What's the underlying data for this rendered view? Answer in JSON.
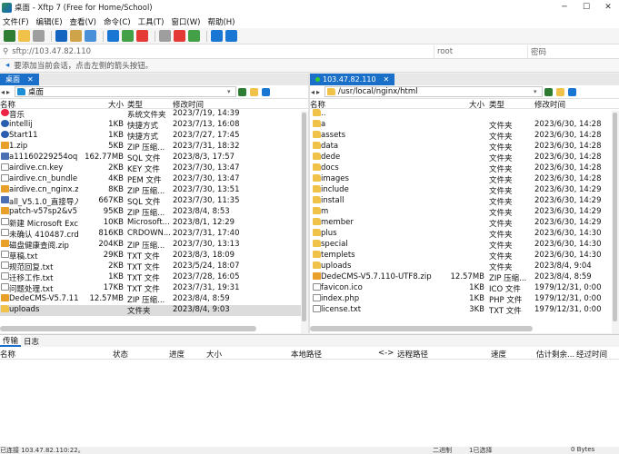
{
  "title": "桌面 - Xftp 7 (Free for Home/School)",
  "menu": [
    "文件(F)",
    "编辑(E)",
    "查看(V)",
    "命令(C)",
    "工具(T)",
    "窗口(W)",
    "帮助(H)"
  ],
  "address": {
    "host": "sftp://103.47.82.110",
    "user_placeholder": "root",
    "pass_placeholder": "密码"
  },
  "hint": "要添加当前会话，点击左侧的箭头按钮。",
  "left": {
    "tab": "桌面",
    "path": "桌面",
    "headers": [
      "名称",
      "大小",
      "类型",
      "修改时间"
    ],
    "files": [
      {
        "n": "音乐",
        "s": "",
        "t": "系统文件夹",
        "d": "2023/7/19, 14:39",
        "i": "sys"
      },
      {
        "n": "intellij",
        "s": "1KB",
        "t": "快捷方式",
        "d": "2023/7/13, 16:08",
        "i": "lnk"
      },
      {
        "n": "Start11",
        "s": "1KB",
        "t": "快捷方式",
        "d": "2023/7/27, 17:45",
        "i": "lnk"
      },
      {
        "n": "1.zip",
        "s": "5KB",
        "t": "ZIP 压缩...",
        "d": "2023/7/31, 18:32",
        "i": "zip"
      },
      {
        "n": "a11160229254oq.sql",
        "s": "162.77MB",
        "t": "SQL 文件",
        "d": "2023/8/3, 17:57",
        "i": "sql"
      },
      {
        "n": "airdive.cn.key",
        "s": "2KB",
        "t": "KEY 文件",
        "d": "2023/7/30, 13:47",
        "i": "file"
      },
      {
        "n": "airdive.cn_bundle....",
        "s": "4KB",
        "t": "PEM 文件",
        "d": "2023/7/30, 13:47",
        "i": "file"
      },
      {
        "n": "airdive.cn_nginx.zip",
        "s": "8KB",
        "t": "ZIP 压缩...",
        "d": "2023/7/30, 13:51",
        "i": "zip"
      },
      {
        "n": "all_V5.1.0_直接导入....",
        "s": "667KB",
        "t": "SQL 文件",
        "d": "2023/7/30, 11:35",
        "i": "sql"
      },
      {
        "n": "patch-v57sp2&v57...",
        "s": "95KB",
        "t": "ZIP 压缩...",
        "d": "2023/8/4, 8:53",
        "i": "zip"
      },
      {
        "n": "新建 Microsoft Exc...",
        "s": "10KB",
        "t": "Microsoft...",
        "d": "2023/8/1, 12:29",
        "i": "file"
      },
      {
        "n": "未确认 410487.crdo...",
        "s": "816KB",
        "t": "CRDOWN...",
        "d": "2023/7/31, 17:40",
        "i": "file"
      },
      {
        "n": "磁盘健康查阅.zip",
        "s": "204KB",
        "t": "ZIP 压缩...",
        "d": "2023/7/30, 13:13",
        "i": "zip"
      },
      {
        "n": "草稿.txt",
        "s": "29KB",
        "t": "TXT 文件",
        "d": "2023/8/3, 18:09",
        "i": "file"
      },
      {
        "n": "规范回复.txt",
        "s": "2KB",
        "t": "TXT 文件",
        "d": "2023/5/24, 18:07",
        "i": "file"
      },
      {
        "n": "迁移工作.txt",
        "s": "1KB",
        "t": "TXT 文件",
        "d": "2023/7/28, 16:05",
        "i": "file"
      },
      {
        "n": "问题处理.txt",
        "s": "17KB",
        "t": "TXT 文件",
        "d": "2023/7/31, 19:31",
        "i": "file"
      },
      {
        "n": "DedeCMS-V5.7.11...",
        "s": "12.57MB",
        "t": "ZIP 压缩...",
        "d": "2023/8/4, 8:59",
        "i": "zip"
      },
      {
        "n": "uploads",
        "s": "",
        "t": "文件夹",
        "d": "2023/8/4, 9:03",
        "i": "folder",
        "sel": true
      }
    ]
  },
  "right": {
    "tab": "103.47.82.110",
    "path": "/usr/local/nginx/html",
    "headers": [
      "名称",
      "大小",
      "类型",
      "修改时间"
    ],
    "files": [
      {
        "n": "..",
        "s": "",
        "t": "",
        "d": "",
        "i": "folder"
      },
      {
        "n": "a",
        "s": "",
        "t": "文件夹",
        "d": "2023/6/30, 14:28",
        "i": "folder"
      },
      {
        "n": "assets",
        "s": "",
        "t": "文件夹",
        "d": "2023/6/30, 14:28",
        "i": "folder"
      },
      {
        "n": "data",
        "s": "",
        "t": "文件夹",
        "d": "2023/6/30, 14:28",
        "i": "folder"
      },
      {
        "n": "dede",
        "s": "",
        "t": "文件夹",
        "d": "2023/6/30, 14:28",
        "i": "folder"
      },
      {
        "n": "docs",
        "s": "",
        "t": "文件夹",
        "d": "2023/6/30, 14:28",
        "i": "folder"
      },
      {
        "n": "images",
        "s": "",
        "t": "文件夹",
        "d": "2023/6/30, 14:28",
        "i": "folder"
      },
      {
        "n": "include",
        "s": "",
        "t": "文件夹",
        "d": "2023/6/30, 14:29",
        "i": "folder"
      },
      {
        "n": "install",
        "s": "",
        "t": "文件夹",
        "d": "2023/6/30, 14:29",
        "i": "folder"
      },
      {
        "n": "m",
        "s": "",
        "t": "文件夹",
        "d": "2023/6/30, 14:29",
        "i": "folder"
      },
      {
        "n": "member",
        "s": "",
        "t": "文件夹",
        "d": "2023/6/30, 14:29",
        "i": "folder"
      },
      {
        "n": "plus",
        "s": "",
        "t": "文件夹",
        "d": "2023/6/30, 14:30",
        "i": "folder"
      },
      {
        "n": "special",
        "s": "",
        "t": "文件夹",
        "d": "2023/6/30, 14:30",
        "i": "folder"
      },
      {
        "n": "templets",
        "s": "",
        "t": "文件夹",
        "d": "2023/6/30, 14:30",
        "i": "folder"
      },
      {
        "n": "uploads",
        "s": "",
        "t": "文件夹",
        "d": "2023/8/4, 9:04",
        "i": "folder"
      },
      {
        "n": "DedeCMS-V5.7.110-UTF8.zip",
        "s": "12.57MB",
        "t": "ZIP 压缩...",
        "d": "2023/8/4, 8:59",
        "i": "zip"
      },
      {
        "n": "favicon.ico",
        "s": "1KB",
        "t": "ICO 文件",
        "d": "1979/12/31, 0:00",
        "i": "file"
      },
      {
        "n": "index.php",
        "s": "1KB",
        "t": "PHP 文件",
        "d": "1979/12/31, 0:00",
        "i": "file"
      },
      {
        "n": "license.txt",
        "s": "3KB",
        "t": "TXT 文件",
        "d": "1979/12/31, 0:00",
        "i": "file"
      }
    ]
  },
  "bottom": {
    "tabs": [
      "传输",
      "日志"
    ],
    "headers": [
      "名称",
      "状态",
      "进度",
      "大小",
      "本地路径",
      "<->",
      "远程路径",
      "速度",
      "估计剩余...",
      "经过时间"
    ]
  },
  "status": {
    "left": "已连接 103.47.82.110:22。",
    "mode": "二进制",
    "objects": "1已选择",
    "bytes": "0 Bytes"
  }
}
